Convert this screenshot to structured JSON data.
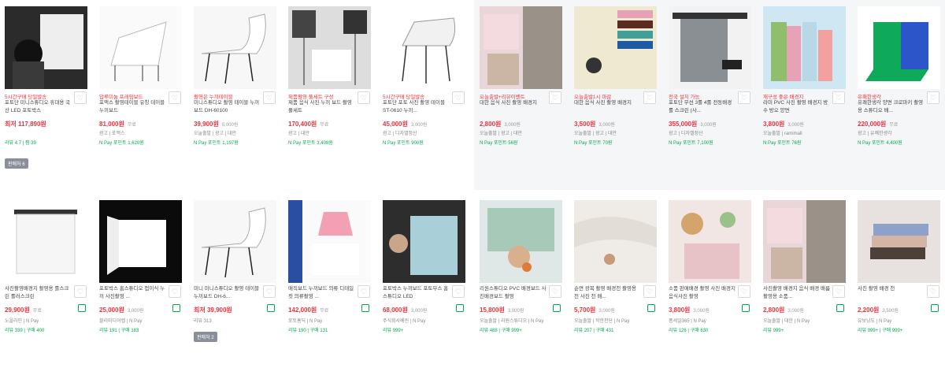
{
  "wish_glyph": "♡",
  "row1": [
    {
      "promo": "5시간구매 당일발송",
      "title": "포토단 미니스튜디오 휴대용 국산 LED 포토박스",
      "price": "최저 117,890원",
      "ship": "",
      "l1": "",
      "l2": "리뷰 4.7 | 찜 39",
      "compare": "판매처 6",
      "img": "camera"
    },
    {
      "promo": "압루미늄 프레임보드",
      "title": "포맥스 촬영테이블 유칭 테이블 누끼보드",
      "price": "81,000원",
      "ship": "무료",
      "l1": "광고 | 포맥스",
      "l2": "N Pay 포인트 1,620원",
      "img": "table"
    },
    {
      "promo": "촬영은 누끼테이블",
      "title": "미니스튜디오 촬영 테이블 누끼보드 DH-60100",
      "price": "39,900원",
      "ship": "5,000원",
      "l1": "오늘출발 | 광고 | 대안",
      "l2": "N Pay 포인트 1,197원",
      "img": "table2"
    },
    {
      "promo": "제품촬영 풀세트 구성",
      "title": "제품 음식 사진 누끼 보드 촬영 풀세트",
      "price": "170,400원",
      "ship": "무료",
      "l1": "광고 | 대안",
      "l2": "N Pay 포인트 3,408원",
      "img": "lights"
    },
    {
      "promo": "5시간구매 당일발송",
      "title": "포토단 포토 사진 촬영 테이블 ST-0610 누끼...",
      "price": "45,000원",
      "ship": "3,000원",
      "l1": "광고 | 디자밸정산",
      "l2": "N Pay 포인트 900원",
      "img": "table3"
    },
    {
      "promo": "오늘출발+리뷰이벤트",
      "title": "대한 음식 사진 촬영 배경지",
      "price": "2,800원",
      "ship": "3,000원",
      "l1": "오늘출발 | 광고 | 대안",
      "l2": "N Pay 포인트 56원",
      "img": "marble"
    },
    {
      "promo": "오늘출발1시 마감",
      "title": "대한 음식 사진 촬영 배경지",
      "price": "3,500원",
      "ship": "3,000원",
      "l1": "오늘출발 | 광고 | 대안",
      "l2": "N Pay 포인트 70원",
      "img": "paper"
    },
    {
      "promo": "전국 설치 가능",
      "title": "포토단 무선 3롤 4롤 전동배경 롤 스크린 (사...",
      "price": "355,000원",
      "ship": "3,000원",
      "l1": "광고 | 디자밸정산",
      "l2": "N Pay 포인트 7,100원",
      "img": "roll"
    },
    {
      "promo": "재구성 좋은 배경지",
      "title": "라미 PVC 사진 촬영 배경지 방수 방오 양면",
      "price": "3,800원",
      "ship": "3,000원",
      "l1": "오늘출발 | ramimall",
      "l2": "N Pay 포인트 76원",
      "img": "rolls"
    },
    {
      "promo": "유패한생각",
      "title": "유쾌한생각 양면 크로마키 촬영용 스튜디오 배...",
      "price": "220,000원",
      "ship": "무료",
      "l1": "광고 | 유쾌한생각",
      "l2": "N Pay 포인트 4,400원",
      "img": "green"
    }
  ],
  "row2": [
    {
      "title": "사진촬영배경지 촬영용 롤스크린 롤러스크린",
      "price": "29,900원",
      "ship": "무료",
      "l1": "노을라인 | N Pay",
      "l2": "리뷰 339 | 구매 400",
      "img": "screen"
    },
    {
      "title": "포토박스 홈스튜디오 접이식 누끼 사진촬영 ...",
      "price": "25,000원",
      "ship": "3,000원",
      "l1": "블리미디어랩 | N Pay",
      "l2": "리뷰 191 | 구매 183",
      "img": "softbox"
    },
    {
      "title": "미니 미니스튜디오 촬영 테이블 누끼보드 DH-6...",
      "price": "최저 39,900원",
      "ship": "",
      "l1": "리뷰 313",
      "l2": "",
      "compare": "판매처 2",
      "img": "table2"
    },
    {
      "title": "매직보드 누끼보드 의류 디테일컷 의류촬영 ...",
      "price": "142,000원",
      "ship": "무료",
      "l1": "포토홈딕 | N Pay",
      "l2": "리뷰 190 | 구매 131",
      "img": "magic"
    },
    {
      "title": "포토박스 누끼보드 포토부스 홈스튜디오 LED",
      "price": "68,000원",
      "ship": "3,000원",
      "l1": "주식회사베린 | N Pay",
      "l2": "리뷰 999+",
      "img": "box"
    },
    {
      "title": "리원스튜디오 PVC 배경보드 사진배경보드 촬영",
      "price": "15,800원",
      "ship": "3,000원",
      "l1": "오늘출발 | 리원스튜디오 | N Pay",
      "l2": "리뷰 488 | 구매 999+",
      "img": "pvc"
    },
    {
      "title": "순면 광목 촬영 배경천 촬영용 천 사진 천 배...",
      "price": "5,700원",
      "ship": "3,000원",
      "l1": "오늘출발 | 작한천단 | N Pay",
      "l2": "리뷰 207 | 구매 431",
      "img": "cloth"
    },
    {
      "title": "소품 판매배경 촬영 사진 배경지 음식사진 촬영",
      "price": "3,800원",
      "ship": "3,000원",
      "l1": "폼세일365 | N Pay",
      "l2": "리뷰 126 | 구매 630",
      "img": "food"
    },
    {
      "title": "사진촬영 배경지 음식 배경 배름 촬영용 소품...",
      "price": "2,800원",
      "ship": "3,000원",
      "l1": "오늘출발 | 대한 | N Pay",
      "l2": "리뷰 999+",
      "img": "marble"
    },
    {
      "title": "사진 촬영 배경 천",
      "price": "2,200원",
      "ship": "3,500원",
      "l1": "유보닝도 | N Pay",
      "l2": "리뷰 999+ | 구매 999+",
      "img": "fabric"
    }
  ]
}
